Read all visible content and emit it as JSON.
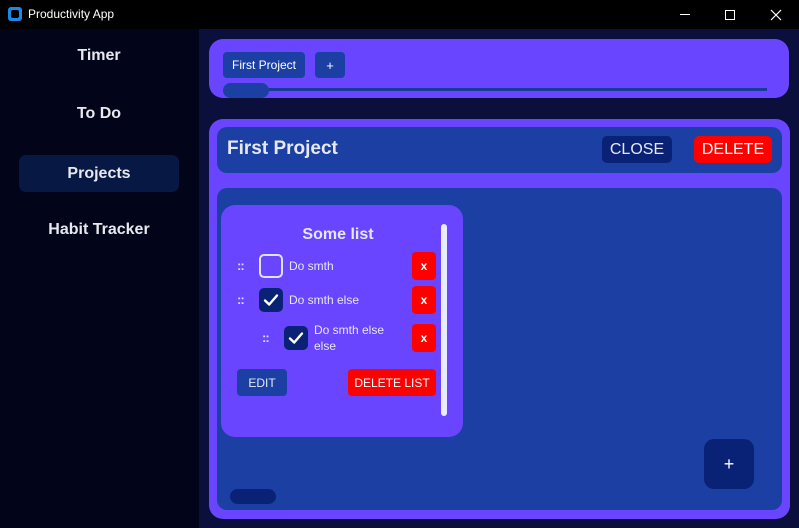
{
  "window": {
    "title": "Productivity App",
    "controls": {
      "minimize": "minimize-icon",
      "maximize": "maximize-icon",
      "close": "close-icon"
    }
  },
  "sidebar": {
    "items": [
      {
        "label": "Timer",
        "active": false
      },
      {
        "label": "To Do",
        "active": false
      },
      {
        "label": "Projects",
        "active": true
      },
      {
        "label": "Habit Tracker",
        "active": false
      }
    ]
  },
  "project_tabs": {
    "tabs": [
      {
        "label": "First Project"
      }
    ],
    "add_label": "+"
  },
  "project": {
    "title": "First Project",
    "close_label": "CLOSE",
    "delete_label": "DELETE",
    "add_list_label": "+",
    "lists": [
      {
        "title": "Some list",
        "items": [
          {
            "text": "Do smth",
            "checked": false,
            "indent": 0,
            "drag_handle": "::",
            "remove_label": "x"
          },
          {
            "text": "Do smth else",
            "checked": true,
            "indent": 0,
            "drag_handle": "::",
            "remove_label": "x"
          },
          {
            "text": "Do smth else else",
            "checked": true,
            "indent": 1,
            "drag_handle": "::",
            "remove_label": "x"
          }
        ],
        "edit_label": "EDIT",
        "delete_list_label": "DELETE LIST"
      }
    ]
  },
  "colors": {
    "accent_purple": "#6a45ff",
    "panel_blue": "#1b3fa3",
    "dark_blue": "#0a2275",
    "danger_red": "#ff0000",
    "sidebar_bg": "#02051a",
    "active_nav": "#071845"
  }
}
